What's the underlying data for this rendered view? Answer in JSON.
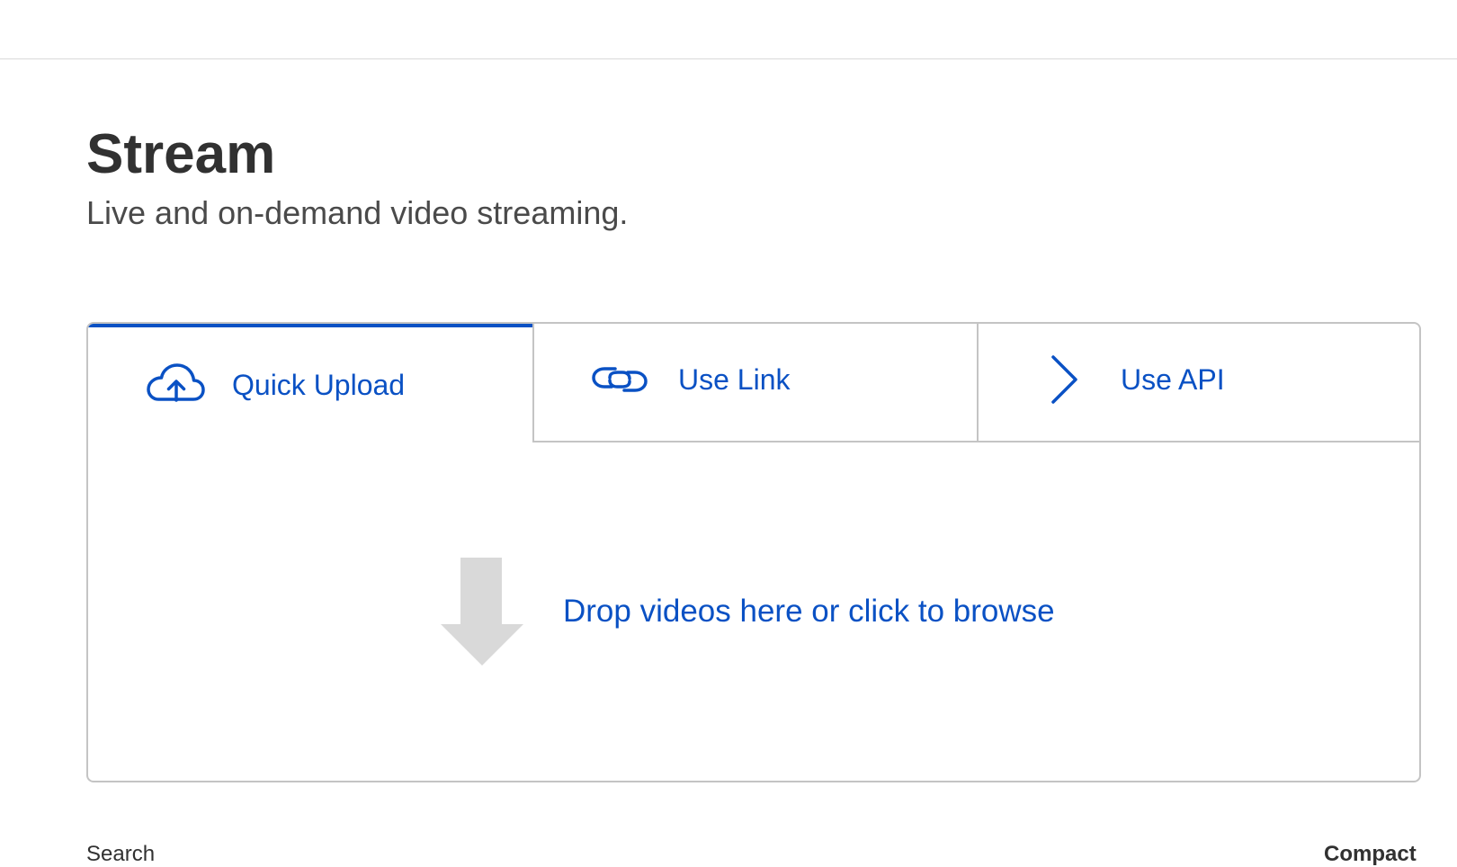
{
  "page": {
    "title": "Stream",
    "subtitle": "Live and on-demand video streaming."
  },
  "upload": {
    "tabs": [
      {
        "label": "Quick Upload",
        "icon": "cloud-upload-icon",
        "active": true
      },
      {
        "label": "Use Link",
        "icon": "link-icon",
        "active": false
      },
      {
        "label": "Use API",
        "icon": "chevron-right-icon",
        "active": false
      }
    ],
    "dropzone_text": "Drop videos here or click to browse",
    "dropzone_icon": "down-arrow-icon"
  },
  "list": {
    "search_label": "Search",
    "view_label": "Compact"
  },
  "colors": {
    "accent": "#0a51c4",
    "border": "#c4c4c4",
    "title_text": "#313131",
    "arrow": "#d9d9d9"
  }
}
